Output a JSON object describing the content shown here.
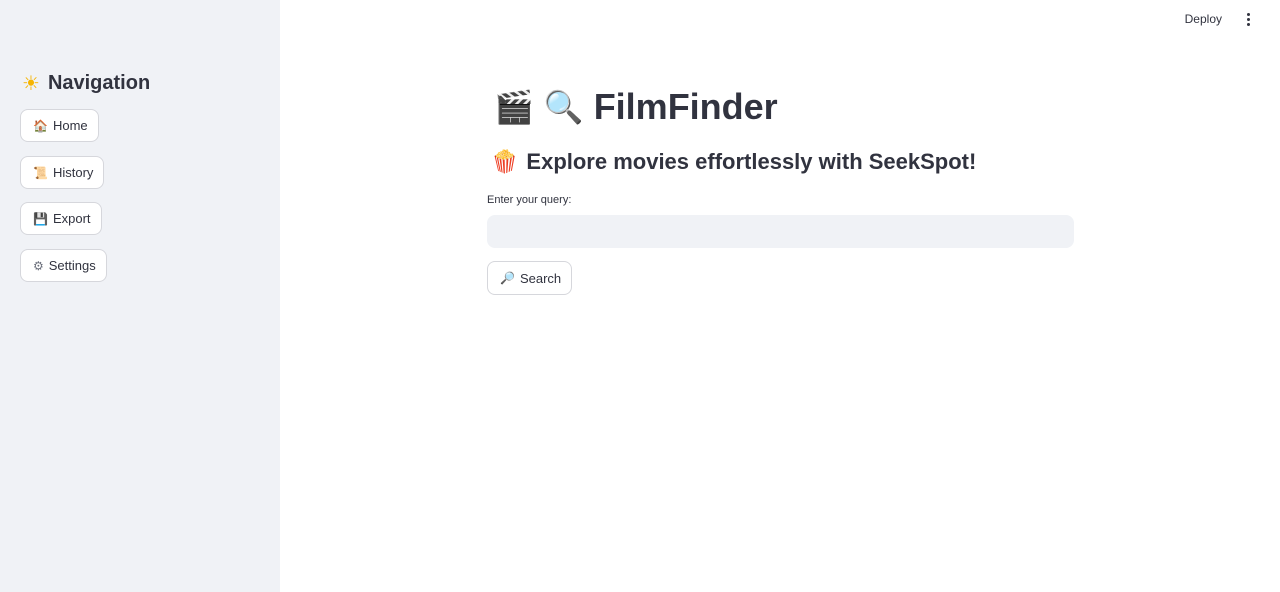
{
  "header": {
    "deploy_label": "Deploy",
    "menu_icon": "more-vertical-icon"
  },
  "sidebar": {
    "title_icon": "☀",
    "title": "Navigation",
    "items": [
      {
        "icon": "🏠",
        "icon_name": "house-icon",
        "label": "Home"
      },
      {
        "icon": "📜",
        "icon_name": "scroll-icon",
        "label": "History"
      },
      {
        "icon": "💾",
        "icon_name": "floppy-disk-icon",
        "label": "Export"
      },
      {
        "icon": "⚙",
        "icon_name": "gear-icon",
        "label": "Settings"
      }
    ]
  },
  "main": {
    "title_icons": [
      "🎬",
      "🔍"
    ],
    "title": "FilmFinder",
    "subtitle_icon": "🍿",
    "subtitle": "Explore movies effortlessly with SeekSpot!",
    "query_label": "Enter your query:",
    "query_value": "",
    "query_placeholder": "",
    "search_icon": "🔎",
    "search_label": "Search"
  }
}
